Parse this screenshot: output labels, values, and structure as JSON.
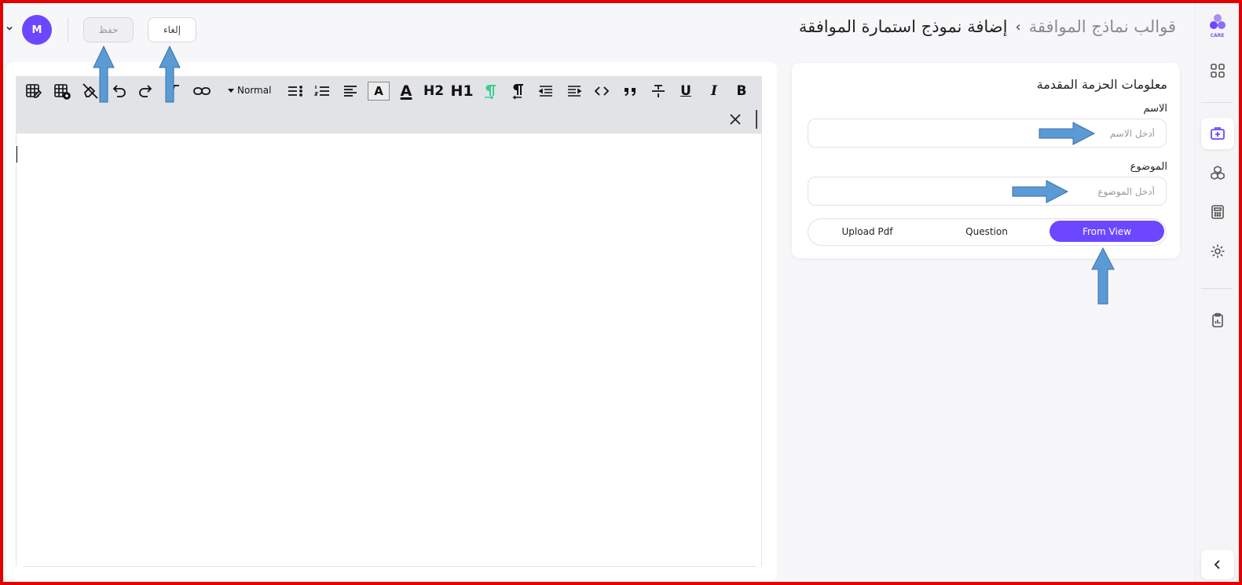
{
  "header": {
    "breadcrumb_prev": "قوالب نماذج الموافقة",
    "breadcrumb_sep": "›",
    "breadcrumb_current": "إضافة نموذج استمارة الموافقة",
    "cancel_label": "إلغاء",
    "save_label": "حفظ",
    "avatar_initial": "M"
  },
  "sidebar": {
    "logo_text": "CARE"
  },
  "editor": {
    "heading_style": "Normal",
    "h1": "H1",
    "h2": "H2",
    "bold": "B",
    "italic": "I",
    "underline": "U",
    "text_color": "A",
    "highlight": "A"
  },
  "info": {
    "title": "معلومات الحزمة المقدمة",
    "name_label": "الاسم",
    "name_placeholder": "أدخل الاسم",
    "subject_label": "الموضوع",
    "subject_placeholder": "أدخل الموضوع",
    "tabs": [
      "Upload Pdf",
      "Question",
      "From View"
    ],
    "active_tab": "From View"
  },
  "colors": {
    "accent": "#6c47ff",
    "frame": "#e10000",
    "arrow": "#5b9bd5",
    "toolbar_bg": "#e2e3e6",
    "rtl_icon": "#3ecf8e"
  }
}
